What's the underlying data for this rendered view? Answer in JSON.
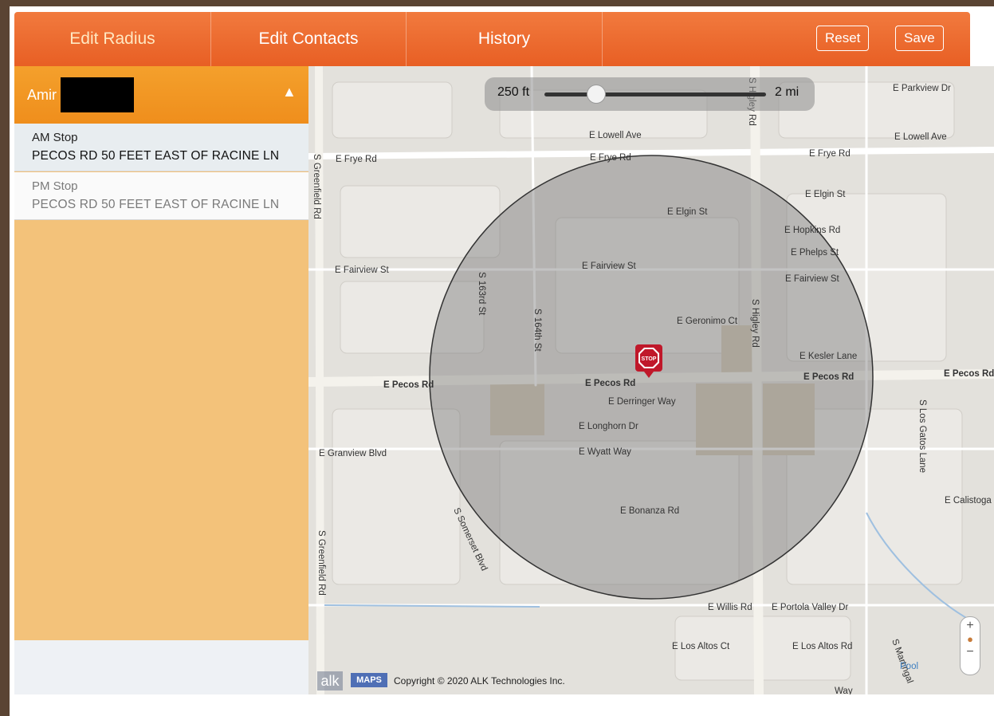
{
  "tabs": [
    {
      "label": "Edit Radius",
      "active": true
    },
    {
      "label": "Edit Contacts",
      "active": false
    },
    {
      "label": "History",
      "active": false
    }
  ],
  "toolbar": {
    "reset_label": "Reset",
    "save_label": "Save"
  },
  "colors": {
    "header": "#e8652a",
    "sidebar_header": "#f2982a",
    "sidebar": "#f3c27a",
    "radius_fill": "#777777"
  },
  "sidebar": {
    "name": "Amir",
    "stops": [
      {
        "type": "AM Stop",
        "address": "PECOS RD 50 FEET EAST OF RACINE LN",
        "selected": true
      },
      {
        "type": "PM Stop",
        "address": "PECOS RD 50 FEET EAST OF RACINE LN",
        "selected": false
      }
    ]
  },
  "radius_slider": {
    "min_label": "250 ft",
    "max_label": "2 mi",
    "position_fraction": 0.24
  },
  "map": {
    "street_labels": [
      "E Parkview Dr",
      "E Lowell Ave",
      "E Frye Rd",
      "E Elgin St",
      "E Hopkins Rd",
      "E Phelps St",
      "E Fairview St",
      "S 163rd St",
      "S 164th St",
      "E Geronimo Ct",
      "S Higley Rd",
      "E Kesler Lane",
      "E Pecos Rd",
      "E Derringer Way",
      "E Longhorn Dr",
      "E Wyatt Way",
      "E Granview Blvd",
      "S Somerset Blvd",
      "E Bonanza Rd",
      "S Greenfield Rd",
      "E Willis Rd",
      "E Portola Valley Dr",
      "E Los Altos Ct",
      "E Los Altos Rd",
      "S Los Gatos Lane",
      "E Calistoga",
      "S Martingal",
      "Pool",
      "Way"
    ],
    "marker_label": "STOP",
    "logo": "alk",
    "maps_badge": "MAPS",
    "copyright": "Copyright © 2020 ALK Technologies Inc.",
    "zoom_in": "+",
    "zoom_out": "−",
    "icons": [
      "stop-sign-icon",
      "zoom-in-icon",
      "zoom-out-icon",
      "person-icon"
    ]
  }
}
